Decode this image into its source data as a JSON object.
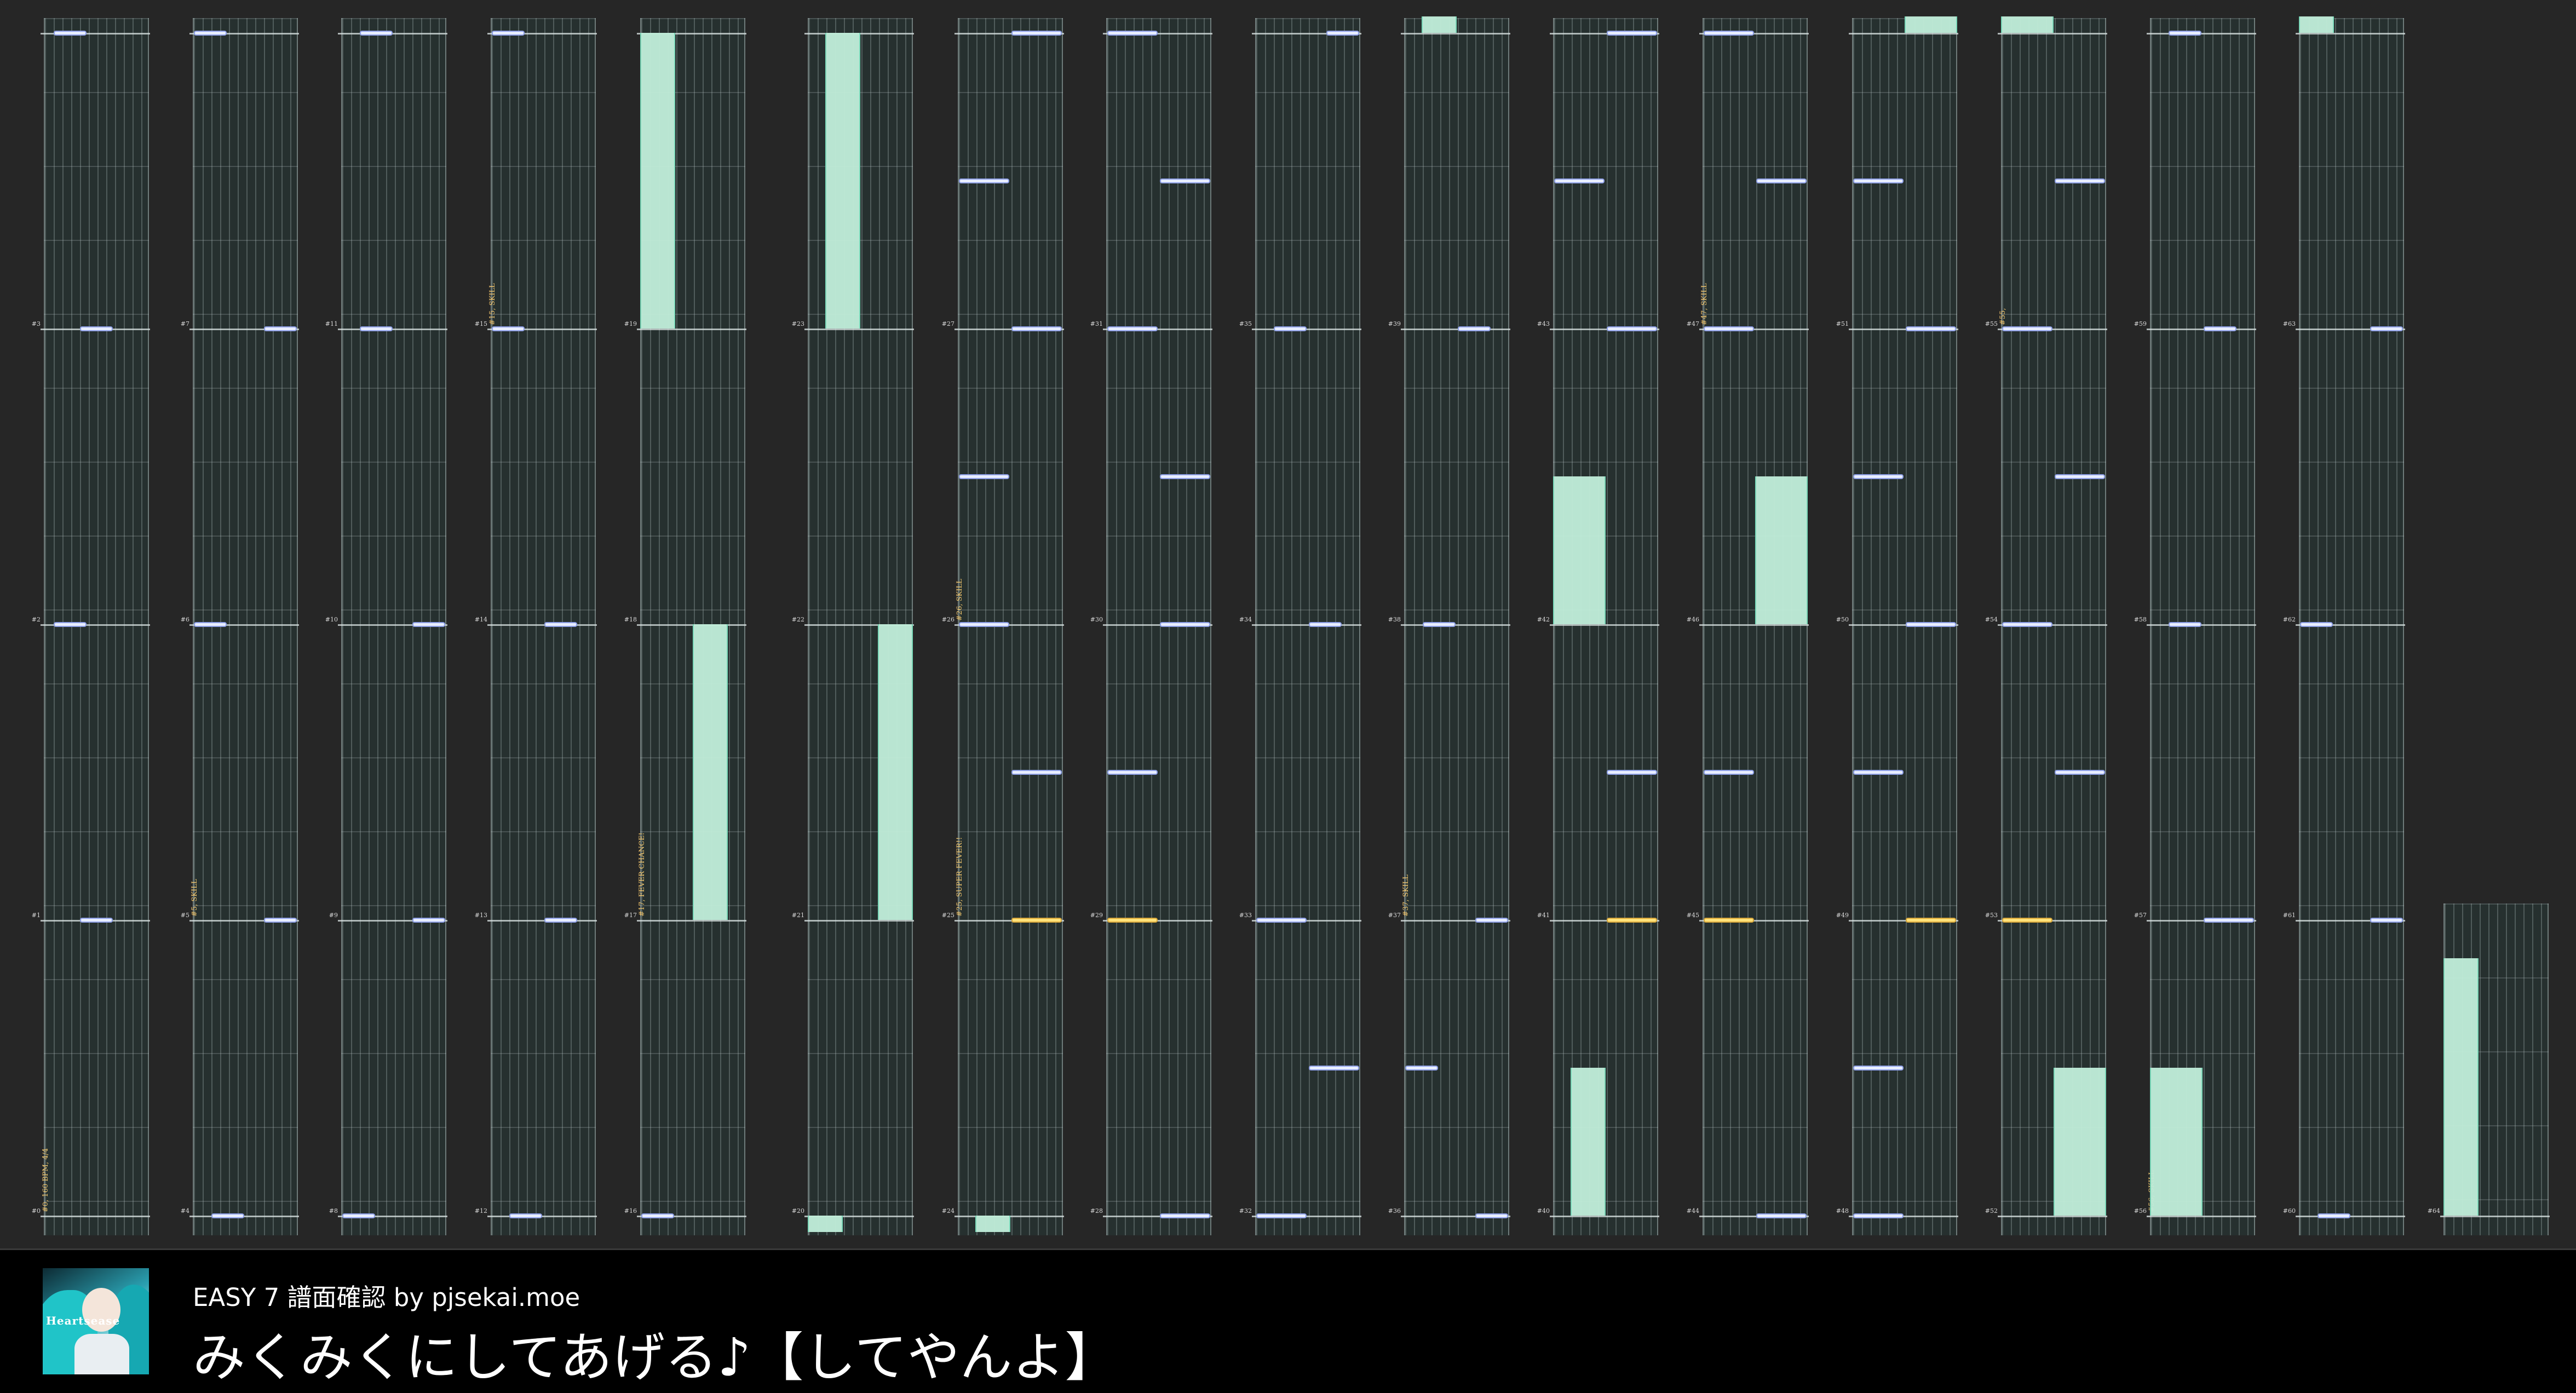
{
  "chart": {
    "columns": [
      {
        "measures": [
          {
            "label": "#3"
          },
          {
            "label": "#2"
          },
          {
            "label": "#1"
          },
          {
            "label": "#0"
          }
        ],
        "events": [
          {
            "text": "#0, 160 BPM, 4/4",
            "measure": 0
          }
        ]
      },
      {
        "measures": [
          {
            "label": "#7"
          },
          {
            "label": "#6"
          },
          {
            "label": "#5"
          },
          {
            "label": "#4"
          }
        ],
        "events": [
          {
            "text": "#5, SKILL",
            "measure": 1
          }
        ]
      },
      {
        "measures": [
          {
            "label": "#11"
          },
          {
            "label": "#10"
          },
          {
            "label": "#9"
          },
          {
            "label": "#8"
          }
        ],
        "events": []
      },
      {
        "measures": [
          {
            "label": "#15"
          },
          {
            "label": "#14"
          },
          {
            "label": "#13"
          },
          {
            "label": "#12"
          }
        ],
        "events": [
          {
            "text": "#15, SKILL",
            "measure": 3
          }
        ]
      },
      {
        "measures": [
          {
            "label": "#19"
          },
          {
            "label": "#18"
          },
          {
            "label": "#17"
          },
          {
            "label": "#16"
          }
        ],
        "events": [
          {
            "text": "#17, FEVER CHANCE!",
            "measure": 1
          }
        ]
      },
      {
        "measures": [
          {
            "label": "#23"
          },
          {
            "label": "#22"
          },
          {
            "label": "#21"
          },
          {
            "label": "#20"
          }
        ],
        "events": []
      },
      {
        "measures": [
          {
            "label": "#27"
          },
          {
            "label": "#26"
          },
          {
            "label": "#25"
          },
          {
            "label": "#24"
          }
        ],
        "events": [
          {
            "text": "#25, SUPER FEVER!!",
            "measure": 1
          },
          {
            "text": "#26, SKILL",
            "measure": 2
          }
        ]
      },
      {
        "measures": [
          {
            "label": "#31"
          },
          {
            "label": "#30"
          },
          {
            "label": "#29"
          },
          {
            "label": "#28"
          }
        ],
        "events": []
      },
      {
        "measures": [
          {
            "label": "#35"
          },
          {
            "label": "#34"
          },
          {
            "label": "#33"
          },
          {
            "label": "#32"
          }
        ],
        "events": []
      },
      {
        "measures": [
          {
            "label": "#39"
          },
          {
            "label": "#38"
          },
          {
            "label": "#37"
          },
          {
            "label": "#36"
          }
        ],
        "events": [
          {
            "text": "#37, SKILL",
            "measure": 1
          }
        ]
      },
      {
        "measures": [
          {
            "label": "#43"
          },
          {
            "label": "#42"
          },
          {
            "label": "#41"
          },
          {
            "label": "#40"
          }
        ],
        "events": []
      },
      {
        "measures": [
          {
            "label": "#47"
          },
          {
            "label": "#46"
          },
          {
            "label": "#45"
          },
          {
            "label": "#44"
          }
        ],
        "events": [
          {
            "text": "#47, SKILL",
            "measure": 3
          }
        ]
      },
      {
        "measures": [
          {
            "label": "#51"
          },
          {
            "label": "#50"
          },
          {
            "label": "#49"
          },
          {
            "label": "#48"
          }
        ],
        "events": []
      },
      {
        "measures": [
          {
            "label": "#55"
          },
          {
            "label": "#54"
          },
          {
            "label": "#53"
          },
          {
            "label": "#52"
          }
        ],
        "events": [
          {
            "text": "#55,",
            "measure": 3
          }
        ]
      },
      {
        "measures": [
          {
            "label": "#59"
          },
          {
            "label": "#58"
          },
          {
            "label": "#57"
          },
          {
            "label": "#56"
          }
        ],
        "events": [
          {
            "text": "#56, SKILL",
            "measure": 0
          }
        ]
      },
      {
        "measures": [
          {
            "label": "#63"
          },
          {
            "label": "#62"
          },
          {
            "label": "#61"
          },
          {
            "label": "#60"
          }
        ],
        "events": []
      },
      {
        "measures": [
          {
            "label": "#64"
          }
        ],
        "events": []
      }
    ]
  },
  "footer": {
    "jacket": {
      "title": "Heartsease"
    },
    "subtitle": "EASY 7 譜面確認 by pjsekai.moe",
    "song_title": "みくみくにしてあげる♪【してやんよ】"
  },
  "colors": {
    "background": "#262626",
    "lane": "#26302f",
    "tap_note": "#e8eeff",
    "critical_note": "#ffe27a",
    "hold": "#bfecd9",
    "event_text": "#f2c66d"
  }
}
